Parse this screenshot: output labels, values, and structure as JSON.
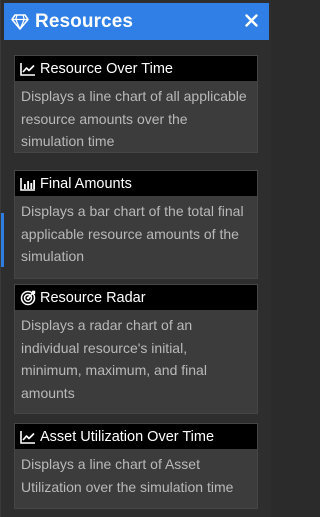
{
  "header": {
    "title": "Resources",
    "icon": "gem-icon",
    "close_icon": "close-icon"
  },
  "colors": {
    "header_bg": "#2f7fe6",
    "panel_bg": "#2e2e2e",
    "card_bg": "#3c3c3c",
    "card_head_bg": "#000000",
    "desc_text": "#b9b9b9"
  },
  "cards": [
    {
      "title": "Resource Over Time",
      "icon": "line-chart-icon",
      "description": "Displays a line chart of all applicable resource amounts over the simulation time"
    },
    {
      "title": "Final Amounts",
      "icon": "bar-chart-icon",
      "description": "Displays a bar chart of the total final applicable resource amounts of the simulation"
    },
    {
      "title": "Resource Radar",
      "icon": "radar-icon",
      "description": "Displays a radar chart of an individual resource's initial, minimum, maximum, and final amounts"
    },
    {
      "title": "Asset Utilization Over Time",
      "icon": "line-chart-icon",
      "description": "Displays a line chart of Asset Utilization over the simulation time"
    }
  ]
}
